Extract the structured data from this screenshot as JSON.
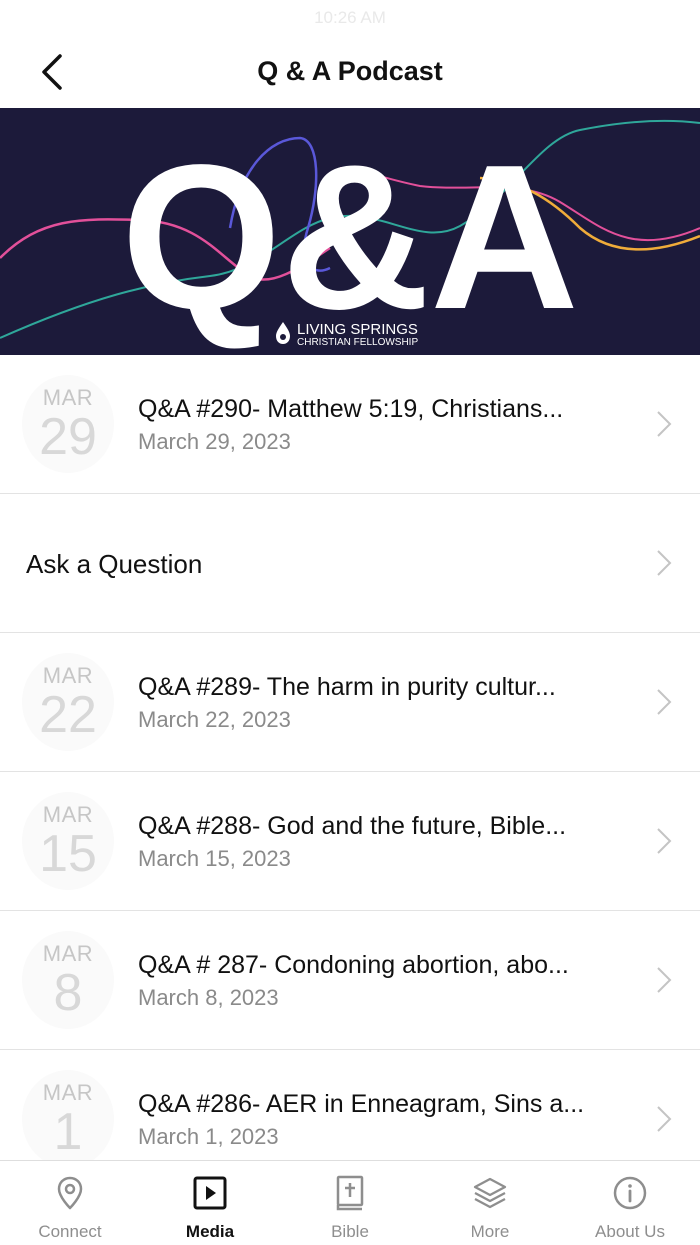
{
  "status_bar": {
    "time": "10:26 AM"
  },
  "header": {
    "title": "Q & A Podcast"
  },
  "hero": {
    "big_text": "Q&A",
    "brand_line1": "LIVING SPRINGS",
    "brand_line2": "CHRISTIAN FELLOWSHIP",
    "background": "#1c1a3a"
  },
  "episodes": [
    {
      "month": "MAR",
      "day": "29",
      "title": "Q&A #290- Matthew 5:19, Christians...",
      "date": "March 29, 2023"
    },
    {
      "month": "MAR",
      "day": "22",
      "title": "Q&A #289- The harm in purity cultur...",
      "date": "March 22, 2023"
    },
    {
      "month": "MAR",
      "day": "15",
      "title": "Q&A #288- God and the future, Bible...",
      "date": "March 15, 2023"
    },
    {
      "month": "MAR",
      "day": "8",
      "title": "Q&A # 287- Condoning abortion, abo...",
      "date": "March 8, 2023"
    },
    {
      "month": "MAR",
      "day": "1",
      "title": "Q&A #286- AER in Enneagram, Sins a...",
      "date": "March 1, 2023"
    }
  ],
  "ask": {
    "label": "Ask a Question"
  },
  "tabs": [
    {
      "label": "Connect",
      "icon": "location-pin-icon"
    },
    {
      "label": "Media",
      "icon": "play-icon"
    },
    {
      "label": "Bible",
      "icon": "bible-icon"
    },
    {
      "label": "More",
      "icon": "layers-icon"
    },
    {
      "label": "About Us",
      "icon": "info-icon"
    }
  ],
  "active_tab": "Media"
}
